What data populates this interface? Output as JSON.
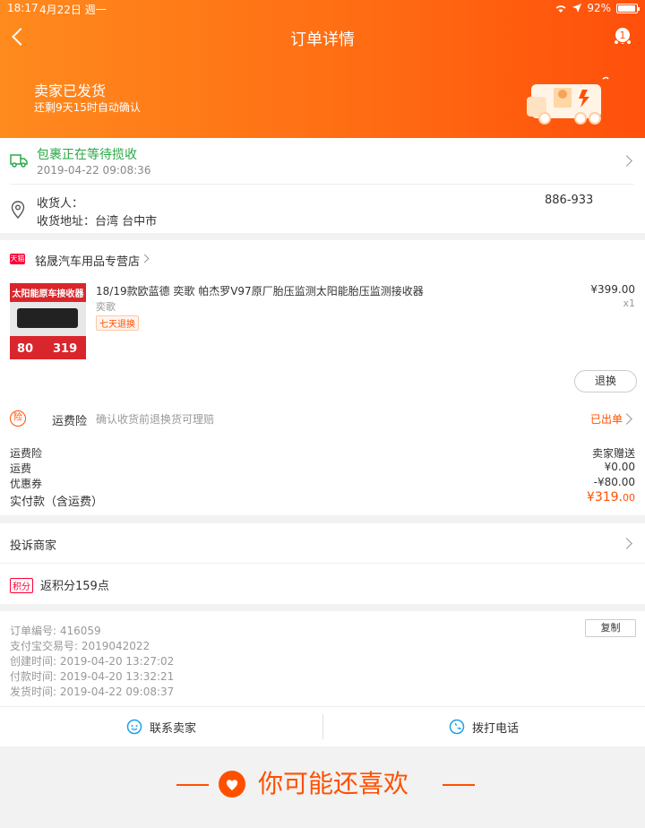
{
  "status_bar": {
    "time": "18:17",
    "date": "4月22日 週一",
    "battery": "92%"
  },
  "nav": {
    "title": "订单详情",
    "badge": "1"
  },
  "hero": {
    "status": "卖家已发货",
    "sub": "还剩9天15时自动确认"
  },
  "logistics": {
    "title": "包裹正在等待揽收",
    "time": "2019-04-22 09:08:36"
  },
  "address": {
    "receiver_label": "收货人：",
    "phone": "886-933",
    "address_label": "收货地址：台湾 台中市"
  },
  "shop": {
    "tag": "天猫",
    "name": "铭晟汽车用品专营店"
  },
  "product": {
    "title": "18/19款欧蓝德 奕歌 帕杰罗V97原厂胎压监测太阳能胎压监测接收器",
    "brand": "奕歌",
    "tag": "七天退换",
    "price": "¥399.00",
    "qty": "x1",
    "img_title": "太阳能原车接收器",
    "img_price1": "80",
    "img_price2": "319"
  },
  "refund_label": "退换",
  "insurance": {
    "icon": "险",
    "label": "运费险",
    "desc": "确认收货前退换货可理赔",
    "status": "已出单"
  },
  "fees": [
    {
      "label": "运费险",
      "value": "卖家赠送"
    },
    {
      "label": "运费",
      "value": "¥0.00"
    },
    {
      "label": "优惠券",
      "value": "-¥80.00"
    }
  ],
  "total": {
    "label": "实付款（含运费）",
    "value": "¥319.",
    "cents": "00"
  },
  "complaint": "投诉商家",
  "points": {
    "tag": "积分",
    "text": "返积分159点"
  },
  "order_info": {
    "order_no": "订单编号:  416059",
    "alipay_no": "支付宝交易号:  2019042022",
    "created": "创建时间:  2019-04-20 13:27:02",
    "paid": "付款时间:  2019-04-20 13:32:21",
    "shipped": "发货时间:  2019-04-22 09:08:37",
    "copy": "复制"
  },
  "contact": {
    "seller": "联系卖家",
    "call": "拨打电话"
  },
  "recommend": "你可能还喜欢",
  "colors": {
    "accent": "#ff5000",
    "green": "#2aa846"
  }
}
